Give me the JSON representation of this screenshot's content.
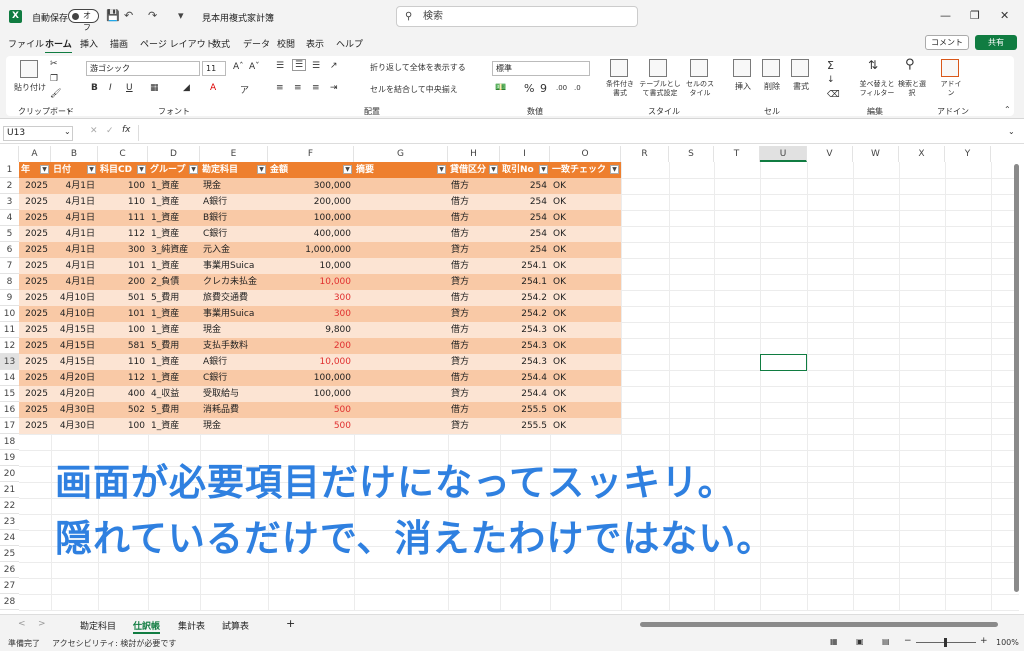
{
  "titlebar": {
    "autosave": "自動保存",
    "toggle": "オフ",
    "docname": "見本用複式家計簿",
    "search_placeholder": "検索"
  },
  "menu": [
    "ファイル",
    "ホーム",
    "挿入",
    "描画",
    "ページ レイアウト",
    "数式",
    "データ",
    "校閲",
    "表示",
    "ヘルプ"
  ],
  "menu_active": "ホーム",
  "buttons": {
    "comment": "コメント",
    "share": "共有"
  },
  "ribbon": {
    "clipboard": {
      "paste": "貼り付け",
      "label": "クリップボード"
    },
    "font": {
      "name": "游ゴシック",
      "size": "11",
      "label": "フォント"
    },
    "align": {
      "wrap": "折り返して全体を表示する",
      "merge": "セルを結合して中央揃え",
      "label": "配置"
    },
    "number": {
      "format": "標準",
      "label": "数値"
    },
    "style": {
      "cond": "条件付き書式",
      "table": "テーブルとして書式設定",
      "cellstyle": "セルのスタイル",
      "label": "スタイル"
    },
    "cells": {
      "insert": "挿入",
      "delete": "削除",
      "format": "書式",
      "label": "セル"
    },
    "edit": {
      "sort": "並べ替えとフィルター",
      "find": "検索と選択",
      "label": "編集"
    },
    "addin": {
      "addin": "アドイン",
      "label": "アドイン"
    }
  },
  "formula_bar": {
    "name_box": "U13",
    "fx": "fx"
  },
  "columns": [
    "A",
    "B",
    "C",
    "D",
    "E",
    "F",
    "G",
    "H",
    "I",
    "O",
    "R",
    "S",
    "T",
    "U",
    "V",
    "W",
    "X",
    "Y"
  ],
  "table_headers": [
    "年",
    "日付",
    "科目CD",
    "グループ",
    "勘定科目",
    "金額",
    "摘要",
    "貸借区分",
    "取引No",
    "一致チェック"
  ],
  "rows": [
    [
      "2025",
      "4月1日",
      "100",
      "1_資産",
      "現金",
      "300,000",
      "",
      "借方",
      "254",
      "OK"
    ],
    [
      "2025",
      "4月1日",
      "110",
      "1_資産",
      "A銀行",
      "200,000",
      "",
      "借方",
      "254",
      "OK"
    ],
    [
      "2025",
      "4月1日",
      "111",
      "1_資産",
      "B銀行",
      "100,000",
      "",
      "借方",
      "254",
      "OK"
    ],
    [
      "2025",
      "4月1日",
      "112",
      "1_資産",
      "C銀行",
      "400,000",
      "",
      "借方",
      "254",
      "OK"
    ],
    [
      "2025",
      "4月1日",
      "300",
      "3_純資産",
      "元入金",
      "1,000,000",
      "",
      "貸方",
      "254",
      "OK"
    ],
    [
      "2025",
      "4月1日",
      "101",
      "1_資産",
      "事業用Suica",
      "10,000",
      "",
      "借方",
      "254.1",
      "OK"
    ],
    [
      "2025",
      "4月1日",
      "200",
      "2_負債",
      "クレカ未払金",
      "10,000",
      "",
      "貸方",
      "254.1",
      "OK"
    ],
    [
      "2025",
      "4月10日",
      "501",
      "5_費用",
      "旅費交通費",
      "300",
      "",
      "借方",
      "254.2",
      "OK"
    ],
    [
      "2025",
      "4月10日",
      "101",
      "1_資産",
      "事業用Suica",
      "300",
      "",
      "貸方",
      "254.2",
      "OK"
    ],
    [
      "2025",
      "4月15日",
      "100",
      "1_資産",
      "現金",
      "9,800",
      "",
      "借方",
      "254.3",
      "OK"
    ],
    [
      "2025",
      "4月15日",
      "581",
      "5_費用",
      "支払手数料",
      "200",
      "",
      "借方",
      "254.3",
      "OK"
    ],
    [
      "2025",
      "4月15日",
      "110",
      "1_資産",
      "A銀行",
      "10,000",
      "",
      "貸方",
      "254.3",
      "OK"
    ],
    [
      "2025",
      "4月20日",
      "112",
      "1_資産",
      "C銀行",
      "100,000",
      "",
      "借方",
      "254.4",
      "OK"
    ],
    [
      "2025",
      "4月20日",
      "400",
      "4_収益",
      "受取給与",
      "100,000",
      "",
      "貸方",
      "254.4",
      "OK"
    ],
    [
      "2025",
      "4月30日",
      "502",
      "5_費用",
      "消耗品費",
      "500",
      "",
      "借方",
      "255.5",
      "OK"
    ],
    [
      "2025",
      "4月30日",
      "100",
      "1_資産",
      "現金",
      "500",
      "",
      "貸方",
      "255.5",
      "OK"
    ]
  ],
  "red_amount_rows": [
    6,
    7,
    8,
    10,
    11,
    14,
    15
  ],
  "colors": {
    "header": "#ee7f2e",
    "row_odd": "#f9c9a6",
    "row_even": "#fce4d3",
    "red": "#e03030",
    "overlay": "#2f80e0"
  },
  "overlay": {
    "line1": "画面が必要項目だけになってスッキリ。",
    "line2": "隠れているだけで、消えたわけではない。"
  },
  "sheets": [
    "勘定科目",
    "仕訳帳",
    "集計表",
    "試算表"
  ],
  "active_sheet": "仕訳帳",
  "status": {
    "ready": "準備完了",
    "access": "アクセシビリティ: 検討が必要です",
    "zoom": "100%"
  }
}
